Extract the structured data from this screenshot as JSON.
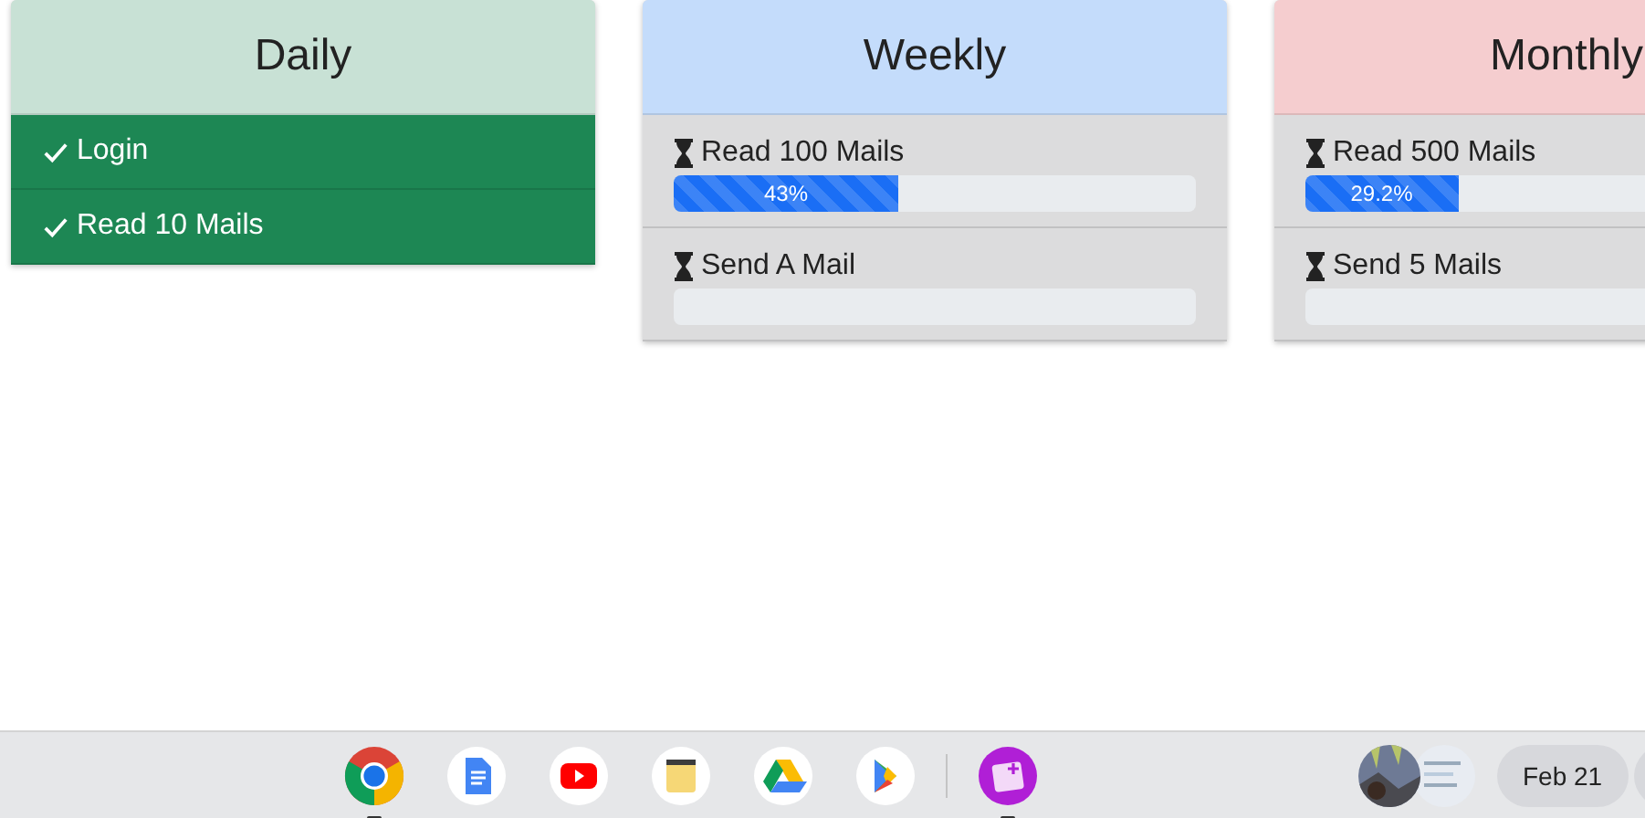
{
  "cards": [
    {
      "title": "Daily",
      "color": "#c8e1d5",
      "tasks": [
        {
          "kind": "done",
          "label": "Login"
        },
        {
          "kind": "done",
          "label": "Read 10 Mails"
        }
      ]
    },
    {
      "title": "Weekly",
      "color": "#c4dcfb",
      "tasks": [
        {
          "kind": "progress",
          "label": "Read 100 Mails",
          "level": 0.43,
          "reading": "43%"
        },
        {
          "kind": "progress",
          "label": "Send A Mail"
        }
      ]
    },
    {
      "title": "Monthly",
      "color": "#f5cdcf",
      "tasks": [
        {
          "kind": "progress",
          "label": "Read 500 Mails",
          "level": 0.292,
          "reading": "29.2%"
        },
        {
          "kind": "progress",
          "label": "Send 5 Mails"
        }
      ]
    }
  ],
  "shelf": {
    "apps": [
      {
        "kind": "chrome",
        "running": true
      },
      {
        "kind": "docs",
        "running": false
      },
      {
        "kind": "youtube",
        "running": false
      },
      {
        "kind": "keep",
        "running": false
      },
      {
        "kind": "drive",
        "running": false
      },
      {
        "kind": "play",
        "running": false
      },
      {
        "kind": "divider"
      },
      {
        "kind": "custom",
        "running": true
      }
    ],
    "date": "Feb 21"
  }
}
